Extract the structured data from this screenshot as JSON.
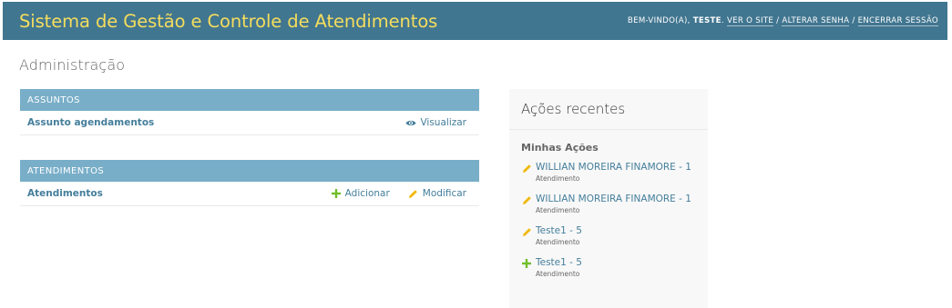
{
  "header": {
    "brand": "Sistema de Gestão e Controle de Atendimentos",
    "welcome": "BEM-VINDO(A), ",
    "username": "TESTE",
    "view_site": "VER O SITE",
    "separator": " / ",
    "change_password": "ALTERAR SENHA",
    "logout": "ENCERRAR SESSÃO"
  },
  "page": {
    "title": "Administração"
  },
  "modules": [
    {
      "caption": "ASSUNTOS",
      "models": [
        {
          "name": "Assunto agendamentos",
          "view_label": "Visualizar"
        }
      ]
    },
    {
      "caption": "ATENDIMENTOS",
      "models": [
        {
          "name": "Atendimentos",
          "add_label": "Adicionar",
          "change_label": "Modificar"
        }
      ]
    }
  ],
  "recent_actions": {
    "title": "Ações recentes",
    "subtitle": "Minhas Ações",
    "items": [
      {
        "icon": "pencil-icon",
        "label": "WILLIAN MOREIRA FINAMORE - 1",
        "type": "Atendimento"
      },
      {
        "icon": "pencil-icon",
        "label": "WILLIAN MOREIRA FINAMORE - 1",
        "type": "Atendimento"
      },
      {
        "icon": "pencil-icon",
        "label": "Teste1 - 5",
        "type": "Atendimento"
      },
      {
        "icon": "plus-icon",
        "label": "Teste1 - 5",
        "type": "Atendimento"
      }
    ]
  },
  "colors": {
    "header_bg": "#417690",
    "brand": "#f5dd5d",
    "caption_bg": "#79aec8",
    "link": "#447e9b",
    "add_green": "#70bf2b",
    "change_yellow": "#efb80b"
  }
}
